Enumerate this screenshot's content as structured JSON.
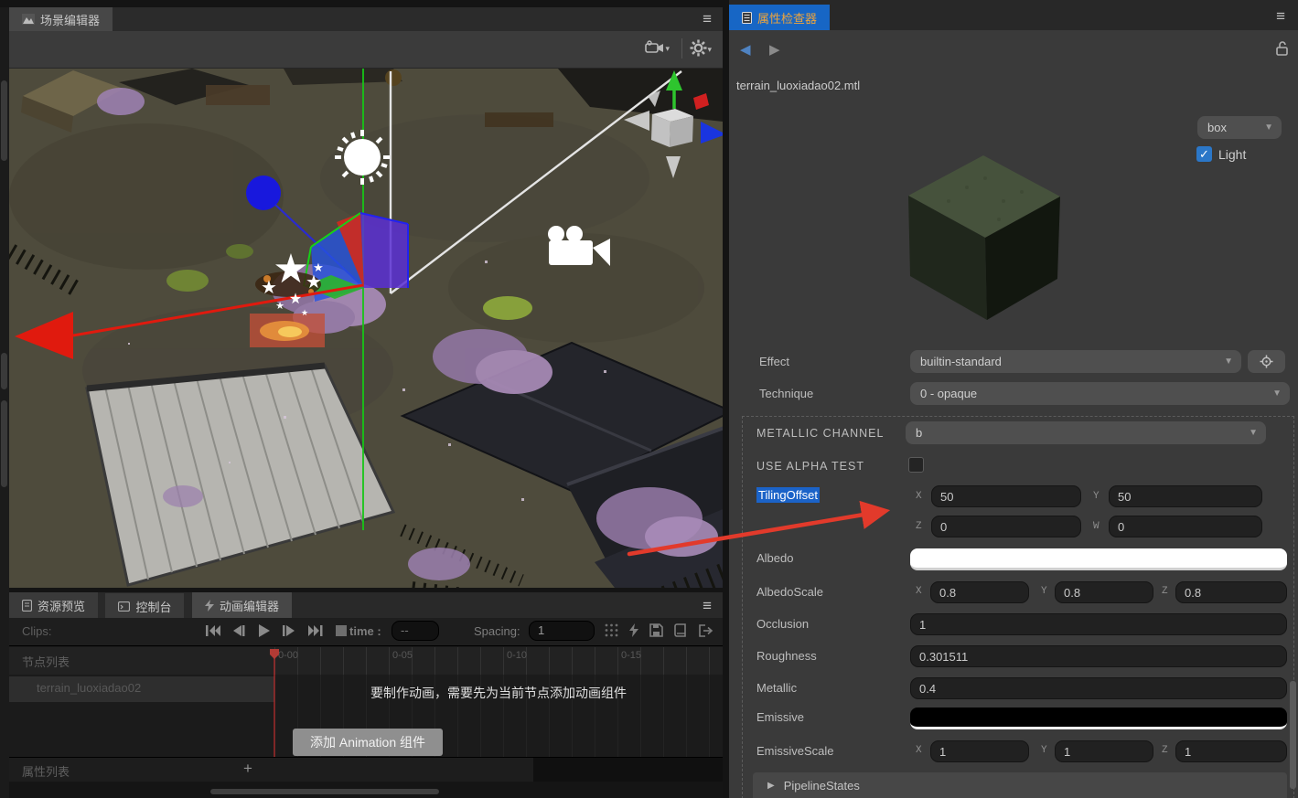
{
  "icons": {
    "menu": "≡",
    "dropdown_arrow": "▼",
    "collapse_arrow": "▶",
    "check": "✓",
    "plus": "+",
    "back": "◀",
    "forward": "▶"
  },
  "scene_editor": {
    "tab_label": "场景编辑器"
  },
  "inspector": {
    "tab_label": "属性检查器",
    "file_name": "terrain_luoxiadao02.mtl",
    "preview": {
      "shape_value": "box",
      "light_label": "Light"
    },
    "effect": {
      "label": "Effect",
      "value": "builtin-standard"
    },
    "technique": {
      "label": "Technique",
      "value": "0 - opaque"
    },
    "axis": {
      "x": "X",
      "y": "Y",
      "z": "Z",
      "w": "W"
    },
    "properties": {
      "metallic_channel": {
        "label": "METALLIC CHANNEL",
        "value": "b"
      },
      "use_alpha_test": {
        "label": "USE ALPHA TEST"
      },
      "tiling_offset": {
        "label": "TilingOffset",
        "x": "50",
        "y": "50",
        "z": "0",
        "w": "0"
      },
      "albedo": {
        "label": "Albedo",
        "color": "#ffffff"
      },
      "albedo_scale": {
        "label": "AlbedoScale",
        "x": "0.8",
        "y": "0.8",
        "z": "0.8"
      },
      "occlusion": {
        "label": "Occlusion",
        "value": "1"
      },
      "roughness": {
        "label": "Roughness",
        "value": "0.301511"
      },
      "metallic": {
        "label": "Metallic",
        "value": "0.4"
      },
      "emissive": {
        "label": "Emissive",
        "color": "#000000"
      },
      "emissive_scale": {
        "label": "EmissiveScale",
        "x": "1",
        "y": "1",
        "z": "1"
      },
      "pipeline_states": {
        "label": "PipelineStates"
      }
    },
    "accent_colors": {
      "selected_tab": "#1766c5",
      "tab_text": "#eda43c",
      "selection_highlight": "#1b63c8",
      "checkbox_blue": "#2b77c8"
    }
  },
  "animation_editor": {
    "tabs": [
      {
        "label": "资源预览"
      },
      {
        "label": "控制台"
      },
      {
        "label": "动画编辑器"
      }
    ],
    "clips_label": "Clips:",
    "time_label": "time :",
    "time_value": "--",
    "spacing_label": "Spacing:",
    "spacing_value": "1",
    "node_list_label": "节点列表",
    "node_name": "terrain_luoxiadao02",
    "ruler_ticks": [
      "0-00",
      "0-05",
      "0-10",
      "0-15"
    ],
    "empty_message": "要制作动画，需要先为当前节点添加动画组件",
    "add_button_label": "添加 Animation 组件",
    "property_list_label": "属性列表"
  },
  "annotation": {
    "arrow_color": "#e23a2b"
  }
}
